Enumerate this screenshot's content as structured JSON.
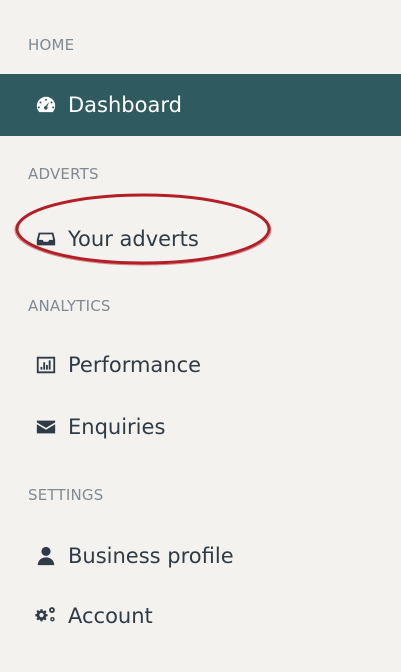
{
  "sections": {
    "home": "HOME",
    "adverts": "ADVERTS",
    "analytics": "ANALYTICS",
    "settings": "SETTINGS"
  },
  "items": {
    "dashboard": {
      "label": "Dashboard",
      "icon": "dashboard-icon"
    },
    "your_adverts": {
      "label": "Your adverts",
      "icon": "inbox-icon"
    },
    "performance": {
      "label": "Performance",
      "icon": "bar-chart-icon"
    },
    "enquiries": {
      "label": "Enquiries",
      "icon": "envelope-icon"
    },
    "business_profile": {
      "label": "Business profile",
      "icon": "user-icon"
    },
    "account": {
      "label": "Account",
      "icon": "gears-icon"
    }
  },
  "colors": {
    "active_background": "#2f5a5f",
    "annotation_ellipse": "#b41f27",
    "section_text": "#808a93",
    "page_background": "#f3f2ef"
  }
}
